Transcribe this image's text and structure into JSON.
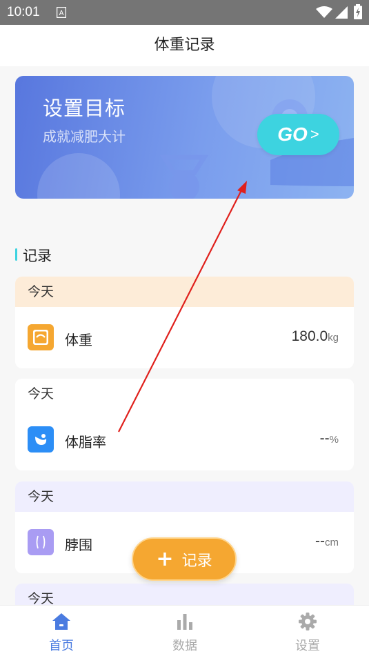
{
  "status_bar": {
    "time": "10:01",
    "indicator": "A"
  },
  "header": {
    "title": "体重记录"
  },
  "banner": {
    "title": "设置目标",
    "subtitle": "成就减肥大计",
    "go_label": "GO",
    "go_arrow": ">"
  },
  "section": {
    "title": "记录"
  },
  "records": [
    {
      "date": "今天",
      "name": "体重",
      "value": "180.0",
      "unit": "kg",
      "icon": "scale-icon",
      "color": "#f5a731",
      "header_bg": "#fdecd8"
    },
    {
      "date": "今天",
      "name": "体脂率",
      "value": "--",
      "unit": "%",
      "icon": "body-fat-icon",
      "color": "#2c8ef6",
      "header_bg": "#ffffff"
    },
    {
      "date": "今天",
      "name": "脖围",
      "value": "--",
      "unit": "cm",
      "icon": "neck-icon",
      "color": "#a99cf3",
      "header_bg": "#efeefe"
    },
    {
      "date": "今天"
    }
  ],
  "fab": {
    "plus": "+",
    "label": "记录"
  },
  "nav": [
    {
      "label": "首页",
      "icon": "home-icon",
      "active": true,
      "color": "#4a7be0"
    },
    {
      "label": "数据",
      "icon": "bar-chart-icon",
      "active": false,
      "color": "#aaaaaa"
    },
    {
      "label": "设置",
      "icon": "gear-icon",
      "active": false,
      "color": "#aaaaaa"
    }
  ]
}
